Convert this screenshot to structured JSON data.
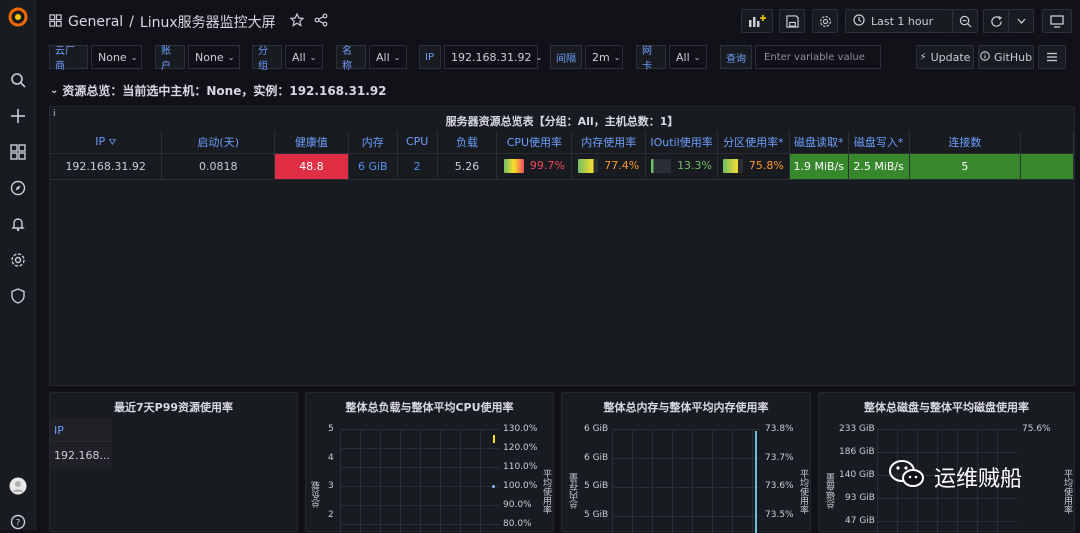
{
  "breadcrumb": {
    "folder": "General",
    "separator": "/",
    "dashboard": "Linux服务器监控大屏"
  },
  "topbar": {
    "time_range": "Last 1 hour"
  },
  "variables": [
    {
      "label": "云厂商",
      "value": "None"
    },
    {
      "label": "账户",
      "value": "None"
    },
    {
      "label": "分组",
      "value": "All"
    },
    {
      "label": "名称",
      "value": "All"
    },
    {
      "label": "IP",
      "value": "192.168.31.92"
    },
    {
      "label": "间隔",
      "value": "2m"
    },
    {
      "label": "网卡",
      "value": "All"
    },
    {
      "label": "查询",
      "placeholder": "Enter variable value"
    }
  ],
  "links": {
    "update": "Update",
    "github": "GitHub"
  },
  "row": {
    "title": "资源总览：当前选中主机：None，实例：192.168.31.92"
  },
  "overview": {
    "info_icon": "i",
    "title": "服务器资源总览表【分组：All，主机总数：1】",
    "headers": [
      "IP",
      "启动(天)",
      "健康值",
      "内存",
      "CPU",
      "负载",
      "CPU使用率",
      "内存使用率",
      "IOutil使用率",
      "分区使用率*",
      "磁盘读取*",
      "磁盘写入*",
      "连接数"
    ],
    "row": {
      "ip": "192.168.31.92",
      "uptime": "0.0818",
      "health": "48.8",
      "memory": "6 GiB",
      "cpu": "2",
      "load": "5.26",
      "cpu_usage": "99.7%",
      "mem_usage": "77.4%",
      "ioutil": "13.3%",
      "partition": "75.8%",
      "disk_read": "1.9 MiB/s",
      "disk_write": "2.5 MiB/s",
      "connections": "5"
    },
    "colors": {
      "health_bg": "#e02f44",
      "green": "#37872d",
      "ok_text": "#73bf69",
      "warn_text": "#ff9830",
      "crit_text": "#f2495c",
      "value_blue": "#5794f2"
    }
  },
  "p99": {
    "title": "最近7天P99资源使用率",
    "header": "IP",
    "rows": [
      "192.168..."
    ]
  },
  "charts": [
    {
      "title": "整体总负载与整体平均CPU使用率",
      "ylabel_left": "总负载",
      "ylabel_right": "平均使用率",
      "left_ticks": [
        "5",
        "4",
        "3",
        "2"
      ],
      "right_ticks": [
        "130.0%",
        "120.0%",
        "110.0%",
        "100.0%",
        "90.0%",
        "80.0%"
      ]
    },
    {
      "title": "整体总内存与整体平均内存使用率",
      "ylabel_left": "总内存量",
      "ylabel_right": "平均使用率",
      "left_ticks": [
        "6 GiB",
        "6 GiB",
        "5 GiB",
        "5 GiB"
      ],
      "right_ticks": [
        "73.8%",
        "73.7%",
        "73.6%",
        "73.5%"
      ]
    },
    {
      "title": "整体总磁盘与整体平均磁盘使用率",
      "ylabel_left": "总磁盘量",
      "ylabel_right": "平均使用率",
      "left_ticks": [
        "233 GiB",
        "186 GiB",
        "140 GiB",
        "93 GiB",
        "47 GiB"
      ],
      "right_ticks": [
        "75.6%"
      ]
    }
  ],
  "watermark": {
    "text": "运维贼船"
  }
}
